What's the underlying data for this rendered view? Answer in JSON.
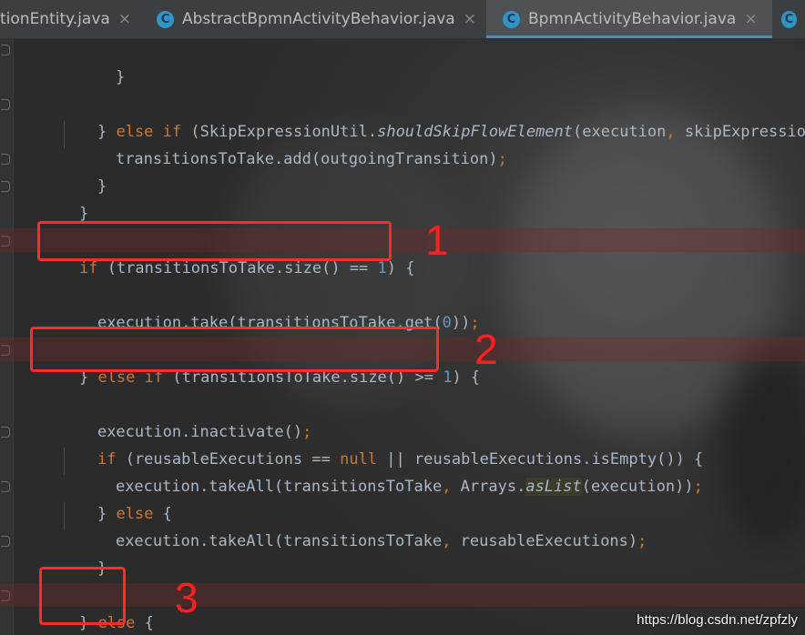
{
  "tabs": [
    {
      "label": "tionEntity.java",
      "has_icon": false,
      "active": false
    },
    {
      "label": "AbstractBpmnActivityBehavior.java",
      "has_icon": true,
      "active": false
    },
    {
      "label": "BpmnActivityBehavior.java",
      "has_icon": true,
      "active": true
    },
    {
      "label": "",
      "has_icon": true,
      "active": false
    }
  ],
  "tab_icon_letter": "C",
  "tab_close_glyph": "×",
  "colors": {
    "keyword": "#cc7832",
    "number": "#6897bb",
    "text": "#a9b7c6",
    "annotation_red": "#ff2a2a",
    "tab_active_underline": "#4a88c7"
  },
  "code_lines": [
    {
      "id": "l1",
      "text": "    }"
    },
    {
      "id": "l2",
      "text": "  } else if (SkipExpressionUtil.shouldSkipFlowElement(execution, skipExpression)){"
    },
    {
      "id": "l3",
      "text": "    transitionsToTake.add(outgoingTransition);"
    },
    {
      "id": "l4",
      "text": "  }"
    },
    {
      "id": "l5",
      "text": "}"
    },
    {
      "id": "l6",
      "text": "if (transitionsToTake.size() == 1) {"
    },
    {
      "id": "l7",
      "text": "  execution.take(transitionsToTake.get(0));"
    },
    {
      "id": "l8",
      "text": "} else if (transitionsToTake.size() >= 1) {"
    },
    {
      "id": "l9",
      "text": "  execution.inactivate();"
    },
    {
      "id": "l10",
      "text": "  if (reusableExecutions == null || reusableExecutions.isEmpty()) {"
    },
    {
      "id": "l11",
      "text": "    execution.takeAll(transitionsToTake, Arrays.asList(execution));"
    },
    {
      "id": "l12",
      "text": "  } else {"
    },
    {
      "id": "l13",
      "text": "    execution.takeAll(transitionsToTake, reusableExecutions);"
    },
    {
      "id": "l14",
      "text": "  }"
    },
    {
      "id": "l15",
      "text": "} else {"
    }
  ],
  "tokens": {
    "l1": {
      "brace": "}"
    },
    "l2": {
      "brace": "}",
      "kw_else": "else",
      "kw_if": "if",
      "p1": "(SkipExpressionUtil.",
      "method": "shouldSkipFlowElement",
      "p2": "(execution",
      "comma": ",",
      "p3": " skipExpression)){"
    },
    "l3": {
      "p1": "transitionsToTake.add(outgoingTransition)",
      "semi": ";"
    },
    "l4": {
      "brace": "}"
    },
    "l5": {
      "brace": "}"
    },
    "l6": {
      "kw_if": "if",
      "p1": "(transitionsToTake.size() == ",
      "num": "1",
      "p2": ") {"
    },
    "l7": {
      "p1": "execution.take(transitionsToTake.get(",
      "num": "0",
      "p2": "))",
      "semi": ";"
    },
    "l8": {
      "brace": "}",
      "kw_else": "else",
      "kw_if": "if",
      "p1": "(transitionsToTake.size() >= ",
      "num": "1",
      "p2": ") {"
    },
    "l9": {
      "p1": "execution.inactivate()",
      "semi": ";"
    },
    "l10": {
      "kw_if": "if",
      "p1": "(reusableExecutions == ",
      "kw_null": "null",
      "p2": " || reusableExecutions.isEmpty()) {"
    },
    "l11": {
      "p1": "execution.takeAll(transitionsToTake",
      "comma": ",",
      "p2": " Arrays.",
      "method": "asList",
      "p3": "(execution))",
      "semi": ";"
    },
    "l12": {
      "brace": "}",
      "kw_else": "else",
      "p1": " {"
    },
    "l13": {
      "p1": "execution.takeAll(transitionsToTake",
      "comma": ",",
      "p2": " reusableExecutions)",
      "semi": ";"
    },
    "l14": {
      "brace": "}"
    },
    "l15": {
      "brace": "}",
      "kw_else": "else",
      "p1": " {"
    }
  },
  "annotations": [
    {
      "label": "1"
    },
    {
      "label": "2"
    },
    {
      "label": "3"
    }
  ],
  "watermark": "https://blog.csdn.net/zpfzly"
}
